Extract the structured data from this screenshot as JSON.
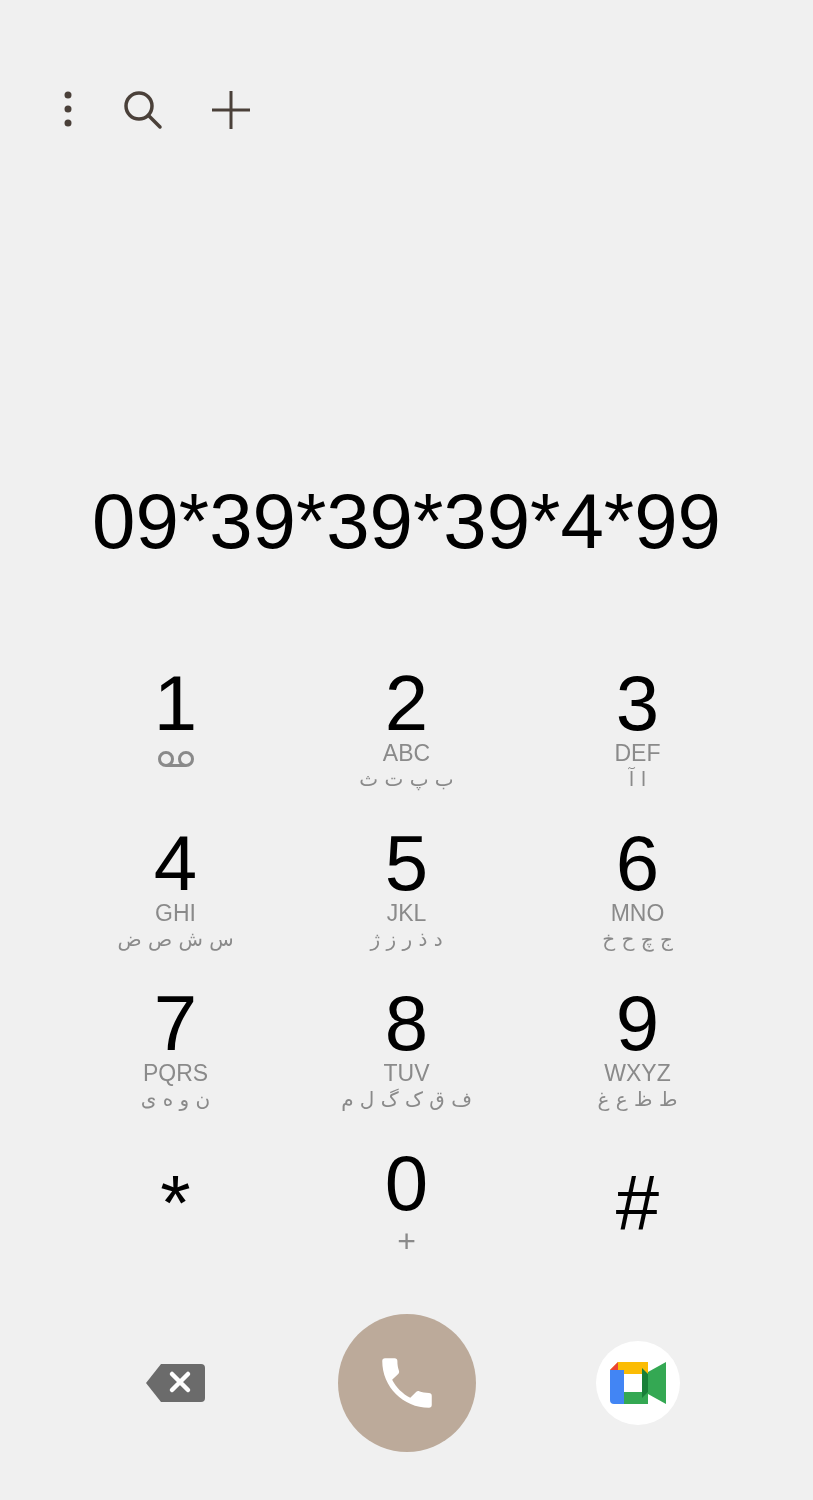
{
  "dialed_number": "09*39*39*39*4*99",
  "keypad_rows": [
    {
      "keys": [
        {
          "digit": "3",
          "kind": "letters",
          "letters": "DEF",
          "alt": "ا آ"
        },
        {
          "digit": "2",
          "kind": "letters",
          "letters": "ABC",
          "alt": "ب پ ت ث"
        },
        {
          "digit": "1",
          "kind": "voicemail"
        }
      ]
    },
    {
      "keys": [
        {
          "digit": "6",
          "kind": "letters",
          "letters": "MNO",
          "alt": "ج چ ح خ"
        },
        {
          "digit": "5",
          "kind": "letters",
          "letters": "JKL",
          "alt": "د ذ ر ز ژ"
        },
        {
          "digit": "4",
          "kind": "letters",
          "letters": "GHI",
          "alt": "س ش ص ض"
        }
      ]
    },
    {
      "keys": [
        {
          "digit": "9",
          "kind": "letters",
          "letters": "WXYZ",
          "alt": "ط ظ ع غ"
        },
        {
          "digit": "8",
          "kind": "letters",
          "letters": "TUV",
          "alt": "ف ق ک گ ل م"
        },
        {
          "digit": "7",
          "kind": "letters",
          "letters": "PQRS",
          "alt": "ن و ه ی"
        }
      ]
    },
    {
      "keys": [
        {
          "digit": "#",
          "kind": "symbol"
        },
        {
          "digit": "0",
          "kind": "plus",
          "sub": "+"
        },
        {
          "digit": "*",
          "kind": "symbol"
        }
      ]
    }
  ]
}
